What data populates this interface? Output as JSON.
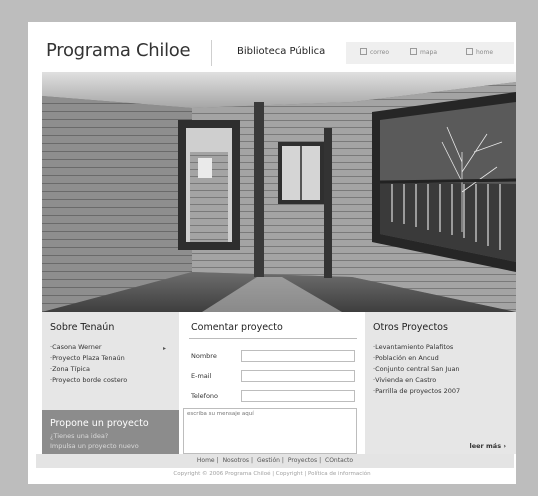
{
  "header": {
    "site_title": "Programa Chiloe",
    "subtitle": "Biblioteca Pública",
    "links": [
      {
        "label": "correo",
        "icon": "mail-icon"
      },
      {
        "label": "mapa",
        "icon": "map-icon"
      },
      {
        "label": "home",
        "icon": "home-icon"
      }
    ]
  },
  "left": {
    "title": "Sobre Tenaún",
    "items": [
      "·Casona Werner",
      "·Proyecto Plaza Tenaún",
      "·Zona Típica",
      "·Proyecto borde costero"
    ],
    "propone_title": "Propone un proyecto",
    "propone_lines": [
      "¿Tienes una idea?",
      "Impulsa un proyecto nuevo"
    ]
  },
  "middle": {
    "title": "Comentar proyecto",
    "fields": [
      {
        "label": "Nombre",
        "value": ""
      },
      {
        "label": "E-mail",
        "value": ""
      },
      {
        "label": "Telefono",
        "value": ""
      }
    ],
    "message_placeholder": "escriba su mensaje aquí"
  },
  "right": {
    "title": "Otros Proyectos",
    "items": [
      "·Levantamiento Palafitos",
      "·Población en Ancud",
      "·Conjunto central San Juan",
      "·Vivienda en Castro",
      "·Parrilla de proyectos 2007"
    ],
    "more_label": "leer más  ›"
  },
  "footer": {
    "nav": [
      "Home",
      "Nosotros",
      "Gestión",
      "Proyectos",
      "COntacto"
    ],
    "copyright": "Copyright © 2006 Programa Chiloé | Copyright  | Política de información"
  }
}
